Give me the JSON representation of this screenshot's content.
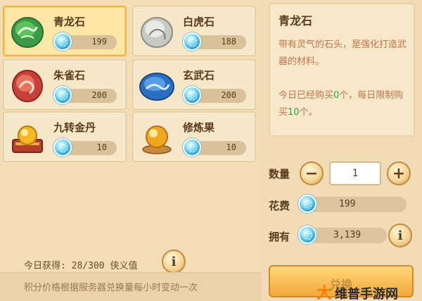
{
  "items": [
    {
      "name": "青龙石",
      "price": "199",
      "icon": "green-dragon-stone-icon",
      "selected": true
    },
    {
      "name": "白虎石",
      "price": "188",
      "icon": "white-tiger-stone-icon",
      "selected": false
    },
    {
      "name": "朱雀石",
      "price": "200",
      "icon": "vermilion-bird-stone-icon",
      "selected": false
    },
    {
      "name": "玄武石",
      "price": "200",
      "icon": "black-tortoise-stone-icon",
      "selected": false
    },
    {
      "name": "九转金丹",
      "price": "10",
      "icon": "golden-elixir-icon",
      "selected": false
    },
    {
      "name": "修炼果",
      "price": "10",
      "icon": "cultivation-fruit-icon",
      "selected": false
    }
  ],
  "footer": {
    "earned_text": "今日获得: 28/300 侠义值",
    "note_text": "积分价格根据服务器兑换量每小时变动一次",
    "info_label": "i"
  },
  "detail": {
    "title": "青龙石",
    "description": "带有灵气的石头，是强化打造武器的材料。",
    "limit_prefix": "今日已经购买",
    "limit_bought": "0",
    "limit_mid": "个，每日限制购买",
    "limit_max": "10",
    "limit_suffix": "个。"
  },
  "purchase": {
    "quantity_label": "数量",
    "quantity_value": "1",
    "minus_label": "−",
    "plus_label": "+",
    "cost_label": "花费",
    "cost_value": "199",
    "owned_label": "拥有",
    "owned_value": "3,139",
    "info_label": "i",
    "buy_label": "兑换"
  },
  "watermark": {
    "mark": "大",
    "text": "维普手游网"
  },
  "colors": {
    "background": "#f1dcb6",
    "card": "#f6e7c8",
    "selected_card": "#fbe6a6",
    "accent_text": "#c2734a",
    "highlight_number": "#2ea84a"
  }
}
